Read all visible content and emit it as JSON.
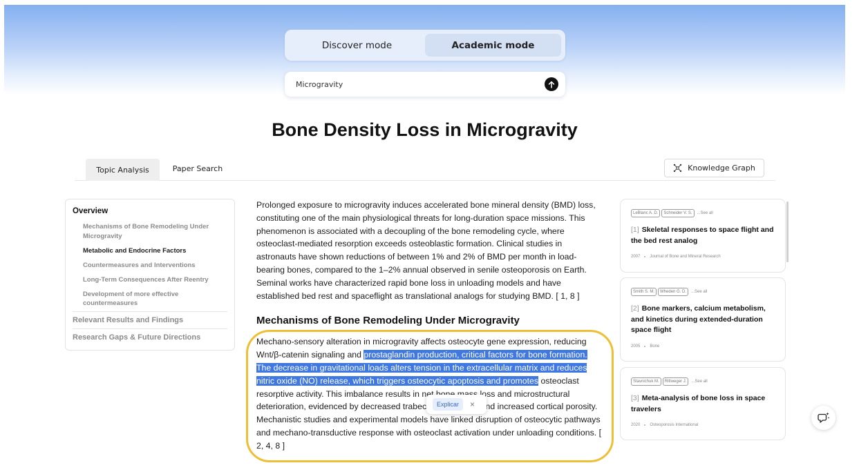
{
  "modes": {
    "discover": "Discover mode",
    "academic": "Academic mode",
    "active": "academic"
  },
  "search": {
    "value": "Microgravity"
  },
  "page_title": "Bone Density Loss in Microgravity",
  "tabs": [
    {
      "label": "Topic Analysis",
      "active": true
    },
    {
      "label": "Paper Search",
      "active": false
    }
  ],
  "knowledge_graph_label": "Knowledge Graph",
  "toc": {
    "overview": "Overview",
    "subsections": [
      "Mechanisms of Bone Remodeling Under Microgravity",
      "Metabolic and Endocrine Factors",
      "Countermeasures and Interventions",
      "Long-Term Consequences After Reentry",
      "Development of more effective countermeasures"
    ],
    "sections": [
      "Relevant Results and Findings",
      "Research Gaps & Future Directions"
    ]
  },
  "content": {
    "intro": "Prolonged exposure to microgravity induces accelerated bone mineral density (BMD) loss, constituting one of the main physiological threats for long-duration space missions. This phenomenon is associated with a decoupling of the bone remodeling cycle, where osteoclast-mediated resorption exceeds osteoblastic formation. Clinical studies in astronauts have shown reductions of between 1% and 2% of BMD per month in load-bearing bones, compared to the 1–2% annual observed in senile osteoporosis on Earth. Seminal works have characterized rapid bone loss in unloading models and have established bed rest and spaceflight as translational analogs for studying BMD. [ 1, 8 ]",
    "section_heading": "Mechanisms of Bone Remodeling Under Microgravity",
    "p2_before": "Mechano-sensory alteration in microgravity affects osteocyte gene expression, reducing Wnt/β-catenin signaling and ",
    "p2_selected": "prostaglandin production, critical factors for bone formation. The decrease in gravitational loads alters tension in the extracellular matrix and reduces nitric oxide (NO) release, which triggers osteocytic apoptosis and promotes",
    "p2_after": " osteoclast resorptive activity. This imbalance results in net bone mass loss and microstructural deterioration, evidenced by decreased trabecular thickness and increased cortical porosity. Mechanistic studies and experimental models have linked disruption of osteocytic pathways and mechano-transductive response with osteoclast activation under unloading conditions. [ 2, 4, 8 ]"
  },
  "selection_popup": {
    "explain_label": "Explicar",
    "close_label": "×"
  },
  "references": [
    {
      "authors": [
        "LeBlanc A. D.",
        "Schneider V. S."
      ],
      "see_all": "...See all",
      "num": "[1]",
      "title": "Skeletal responses to space flight and the bed rest analog",
      "year": "2007",
      "journal": "Journal of Bone and Mineral Research"
    },
    {
      "authors": [
        "Smith S. M.",
        "Wheden G. D."
      ],
      "see_all": "...See all",
      "num": "[2]",
      "title": "Bone markers, calcium metabolism, and kinetics during extended-duration space flight",
      "year": "2005",
      "journal": "Bone"
    },
    {
      "authors": [
        "Stavnichuk M.",
        "Rittweger J."
      ],
      "see_all": "...See all",
      "num": "[3]",
      "title": "Meta-analysis of bone loss in space travelers",
      "year": "2020",
      "journal": "Osteoporosis International"
    }
  ],
  "colors": {
    "accent": "#3f78e0",
    "highlight_ring": "#eebe35",
    "hero_top": "#84b0f0"
  },
  "icons": {
    "submit": "arrow-up-icon",
    "knowledge_graph": "graph-nodes-icon",
    "fab": "sparkle-chat-icon"
  }
}
